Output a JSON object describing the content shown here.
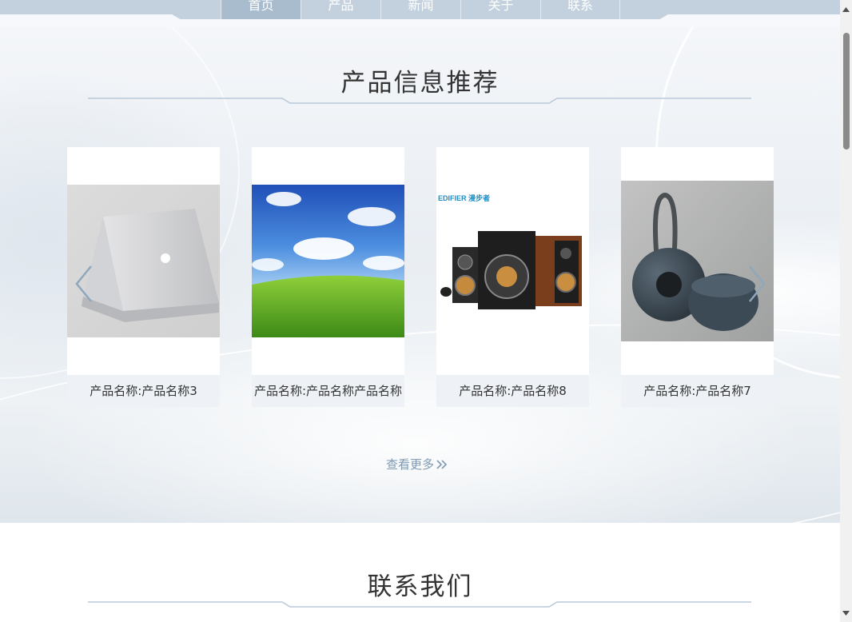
{
  "nav": {
    "tabs": [
      {
        "label": "首页",
        "active": true
      },
      {
        "label": "产品",
        "active": false
      },
      {
        "label": "新闻",
        "active": false
      },
      {
        "label": "关于",
        "active": false
      },
      {
        "label": "联系",
        "active": false
      }
    ]
  },
  "products": {
    "title": "产品信息推荐",
    "items": [
      {
        "caption": "产品名称:产品名称3",
        "image": "laptop"
      },
      {
        "caption": "产品名称:产品名称产品名称",
        "image": "landscape"
      },
      {
        "caption": "产品名称:产品名称8",
        "image": "speakers"
      },
      {
        "caption": "产品名称:产品名称7",
        "image": "bluetooth-speaker"
      }
    ],
    "more_label": "查看更多",
    "brand_label": "EDIFIER 漫步者"
  },
  "contact": {
    "title": "联系我们"
  },
  "colors": {
    "accent": "#7f9ab2",
    "nav": "#c3d1de",
    "divider": "#b9c9d7"
  }
}
